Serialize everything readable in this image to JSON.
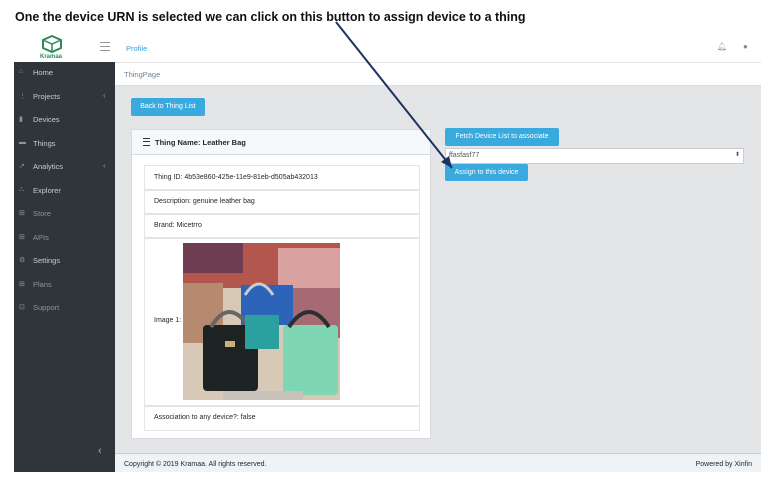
{
  "caption": "One the device URN is selected we can click on this button to assign device to a thing",
  "logo_text": "Kramaa",
  "header": {
    "profile": "Profile"
  },
  "sidebar": {
    "items": [
      {
        "label": "Home",
        "icon": "home-icon",
        "chevron": ""
      },
      {
        "label": "Projects",
        "icon": "projects-icon",
        "chevron": "‹"
      },
      {
        "label": "Devices",
        "icon": "devices-icon",
        "chevron": ""
      },
      {
        "label": "Things",
        "icon": "things-icon",
        "chevron": ""
      },
      {
        "label": "Analytics",
        "icon": "analytics-icon",
        "chevron": "‹"
      },
      {
        "label": "Explorer",
        "icon": "explorer-icon",
        "chevron": ""
      },
      {
        "label": "Store",
        "icon": "store-icon",
        "chevron": ""
      },
      {
        "label": "APIs",
        "icon": "apis-icon",
        "chevron": ""
      },
      {
        "label": "Settings",
        "icon": "settings-icon",
        "chevron": ""
      },
      {
        "label": "Plans",
        "icon": "plans-icon",
        "chevron": ""
      },
      {
        "label": "Support",
        "icon": "support-icon",
        "chevron": ""
      }
    ]
  },
  "breadcrumb": "ThingPage",
  "back_button": "Back to Thing List",
  "thing": {
    "title": "Thing Name: Leather Bag",
    "id": "Thing ID: 4b53e860-425e-11e9-81eb-d505ab432013",
    "description": "Description: genuine leather bag",
    "brand": "Brand: Micetrro",
    "image_label": "Image 1:",
    "association": "Association to any device?: false"
  },
  "device": {
    "fetch_button": "Fetch Device List to associate",
    "selected": "ffasfasf77",
    "assign_button": "Assign to this device"
  },
  "footer": {
    "left": "Copyright © 2019 Kramaa. All rights reserved.",
    "right": "Powered by Xinfin"
  },
  "colors": {
    "accent": "#3aa9dd",
    "sidebar": "#2f353b",
    "arrow": "#1f3264"
  }
}
